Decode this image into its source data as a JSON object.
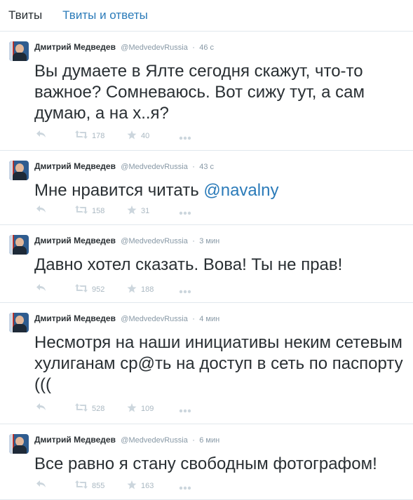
{
  "tabs": {
    "tweets": "Твиты",
    "tweets_replies": "Твиты и ответы"
  },
  "colors": {
    "link": "#2b7bb9",
    "text": "#292f33",
    "muted": "#8899a6",
    "icon": "#ccd6dd"
  },
  "icons": [
    "reply-icon",
    "retweet-icon",
    "favorite-star-icon",
    "more-icon"
  ],
  "tweets": [
    {
      "name": "Дмитрий Медведев",
      "handle": "@MedvedevRussia",
      "time": "46 с",
      "text": "Вы думаете в Ялте сегодня скажут, что-то важное? Сомневаюсь. Вот сижу тут, а сам думаю, а на х..я?",
      "mention": "",
      "retweets": "178",
      "favorites": "40"
    },
    {
      "name": "Дмитрий Медведев",
      "handle": "@MedvedevRussia",
      "time": "43 с",
      "text": "Мне нравится читать ",
      "mention": "@navalny",
      "retweets": "158",
      "favorites": "31"
    },
    {
      "name": "Дмитрий Медведев",
      "handle": "@MedvedevRussia",
      "time": "3 мин",
      "text": "Давно хотел сказать. Вова! Ты не прав!",
      "mention": "",
      "retweets": "952",
      "favorites": "188"
    },
    {
      "name": "Дмитрий Медведев",
      "handle": "@MedvedevRussia",
      "time": "4 мин",
      "text": "Несмотря на наши инициативы неким сетевым хулиганам ср@ть на доступ в сеть по паспорту  (((",
      "mention": "",
      "retweets": "528",
      "favorites": "109"
    },
    {
      "name": "Дмитрий Медведев",
      "handle": "@MedvedevRussia",
      "time": "6 мин",
      "text": "Все равно я стану свободным фотографом!",
      "mention": "",
      "retweets": "855",
      "favorites": "163"
    }
  ]
}
